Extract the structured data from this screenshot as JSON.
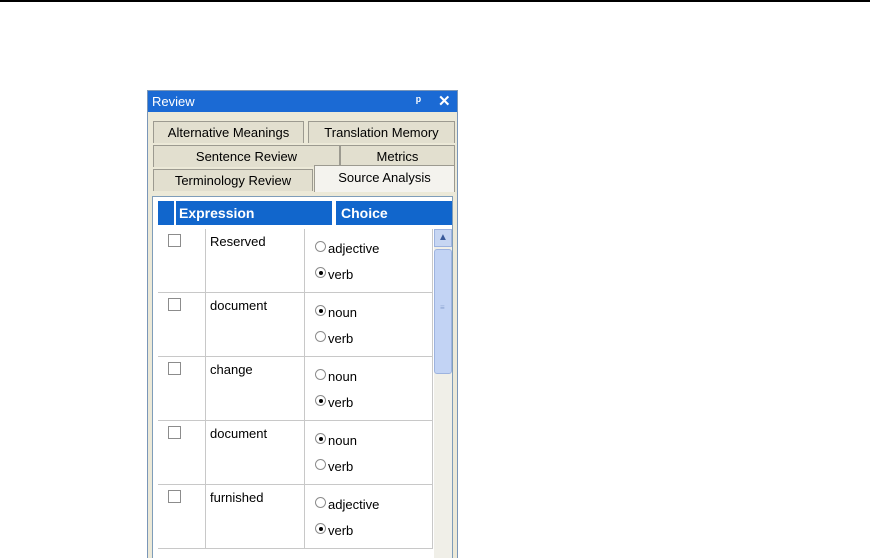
{
  "panel": {
    "title": "Review",
    "pin_glyph": "ᵖ",
    "close_glyph": "✕"
  },
  "tabs": {
    "row1": [
      "Alternative Meanings",
      "Translation Memory"
    ],
    "row2": [
      "Sentence Review",
      "Metrics"
    ],
    "row3": [
      "Terminology Review",
      "Source Analysis"
    ],
    "active": "Source Analysis"
  },
  "grid": {
    "headers": {
      "expression": "Expression",
      "choice": "Choice"
    },
    "rows": [
      {
        "expression": "Reserved",
        "options": [
          "adjective",
          "verb"
        ],
        "selected": "verb",
        "checked": false
      },
      {
        "expression": "document",
        "options": [
          "noun",
          "verb"
        ],
        "selected": "noun",
        "checked": false
      },
      {
        "expression": "change",
        "options": [
          "noun",
          "verb"
        ],
        "selected": "verb",
        "checked": false
      },
      {
        "expression": "document",
        "options": [
          "noun",
          "verb"
        ],
        "selected": "noun",
        "checked": false
      },
      {
        "expression": "furnished",
        "options": [
          "adjective",
          "verb"
        ],
        "selected": "verb",
        "checked": false
      }
    ]
  },
  "colors": {
    "titlebar": "#1b6ad4",
    "header": "#1166cc",
    "panel_bg": "#ece9d8"
  },
  "icons": {
    "scroll_up": "chevron-up-icon",
    "pin": "pin-icon",
    "close": "close-icon"
  }
}
